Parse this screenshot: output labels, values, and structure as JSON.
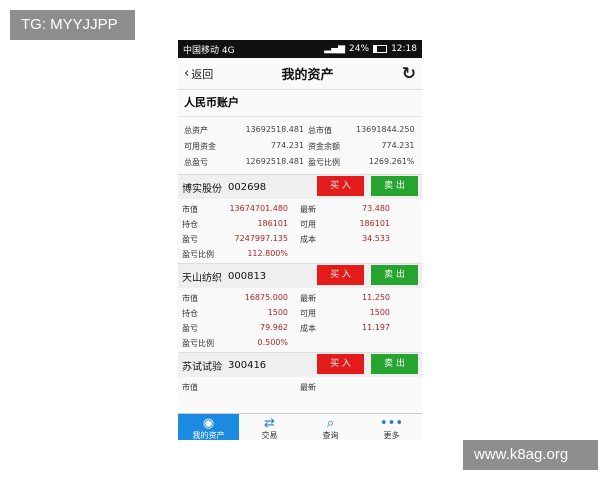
{
  "watermark_top": "TG: MYYJJPP",
  "watermark_bottom": "www.k8ag.org",
  "status": {
    "carrier": "中国移动 4G",
    "battery": "24%",
    "time": "12:18"
  },
  "nav": {
    "back": "返回",
    "title": "我的资产",
    "refresh_icon": "refresh-icon"
  },
  "account": {
    "header": "人民币账户",
    "summary": [
      {
        "label1": "总资产",
        "value1": "13692518.481",
        "label2": "总市值",
        "value2": "13691844.250"
      },
      {
        "label1": "可用资金",
        "value1": "774.231",
        "label2": "资金余额",
        "value2": "774.231"
      },
      {
        "label1": "总盈亏",
        "value1": "12692518.481",
        "label2": "盈亏比例",
        "value2": "1269.261%"
      }
    ]
  },
  "stocks": [
    {
      "name": "博实股份",
      "code": "002698",
      "buy": "买 入",
      "sell": "卖 出",
      "rows": [
        {
          "l1": "市值",
          "v1": "13674701.480",
          "l2": "最新",
          "v2": "73.480"
        },
        {
          "l1": "持仓",
          "v1": "186101",
          "l2": "可用",
          "v2": "186101"
        },
        {
          "l1": "盈亏",
          "v1": "7247997.135",
          "l2": "成本",
          "v2": "34.533"
        },
        {
          "l1": "盈亏比例",
          "v1": "112.800%",
          "l2": "",
          "v2": ""
        }
      ]
    },
    {
      "name": "天山纺织",
      "code": "000813",
      "buy": "买 入",
      "sell": "卖 出",
      "rows": [
        {
          "l1": "市值",
          "v1": "16875.000",
          "l2": "最新",
          "v2": "11.250"
        },
        {
          "l1": "持仓",
          "v1": "1500",
          "l2": "可用",
          "v2": "1500"
        },
        {
          "l1": "盈亏",
          "v1": "79.962",
          "l2": "成本",
          "v2": "11.197"
        },
        {
          "l1": "盈亏比例",
          "v1": "0.500%",
          "l2": "",
          "v2": ""
        }
      ]
    },
    {
      "name": "苏试试验",
      "code": "300416",
      "buy": "买 入",
      "sell": "卖 出",
      "rows": [
        {
          "l1": "市值",
          "v1": "",
          "l2": "最新",
          "v2": ""
        }
      ]
    }
  ],
  "tabs": [
    {
      "label": "我的资产",
      "icon": "user-icon",
      "glyph": "◉",
      "active": true
    },
    {
      "label": "交易",
      "icon": "trade-arrows-icon",
      "glyph": "⇄",
      "active": false
    },
    {
      "label": "查询",
      "icon": "search-icon",
      "glyph": "⌕",
      "active": false
    },
    {
      "label": "更多",
      "icon": "more-icon",
      "glyph": "•••",
      "active": false
    }
  ],
  "colors": {
    "buy": "#e41b1b",
    "sell": "#27a330",
    "tab_active": "#1c8ae0",
    "value_red": "#b22222"
  }
}
